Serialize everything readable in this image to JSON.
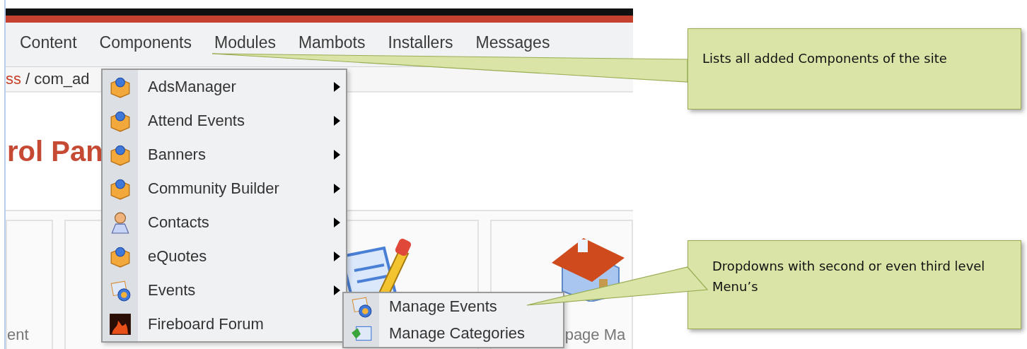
{
  "top_menu": [
    {
      "label": "Content"
    },
    {
      "label": "Components"
    },
    {
      "label": "Modules"
    },
    {
      "label": "Mambots"
    },
    {
      "label": "Installers"
    },
    {
      "label": "Messages"
    }
  ],
  "breadcrumb": {
    "link": "ss",
    "path": "/ com_ad"
  },
  "page_title": "rol Pan",
  "panels": [
    {
      "kind": "plain",
      "label": "ent"
    },
    {
      "kind": "edit"
    },
    {
      "kind": "home",
      "label": "page Ma"
    }
  ],
  "components_menu": [
    {
      "label": "AdsManager",
      "kind": "package",
      "has_submenu": true
    },
    {
      "label": "Attend Events",
      "kind": "package",
      "has_submenu": true
    },
    {
      "label": "Banners",
      "kind": "package",
      "has_submenu": true
    },
    {
      "label": "Community Builder",
      "kind": "package",
      "has_submenu": true
    },
    {
      "label": "Contacts",
      "kind": "person",
      "has_submenu": true
    },
    {
      "label": "eQuotes",
      "kind": "package",
      "has_submenu": true
    },
    {
      "label": "Events",
      "kind": "events",
      "has_submenu": true
    },
    {
      "label": "Fireboard Forum",
      "kind": "flame",
      "has_submenu": false
    }
  ],
  "events_submenu": [
    {
      "label": "Manage Events",
      "kind": "events"
    },
    {
      "label": "Manage Categories",
      "kind": "categories"
    }
  ],
  "callouts": [
    {
      "text": "Lists all added Components of the site"
    },
    {
      "text": "Dropdowns with second or even third level Menu’s"
    }
  ]
}
